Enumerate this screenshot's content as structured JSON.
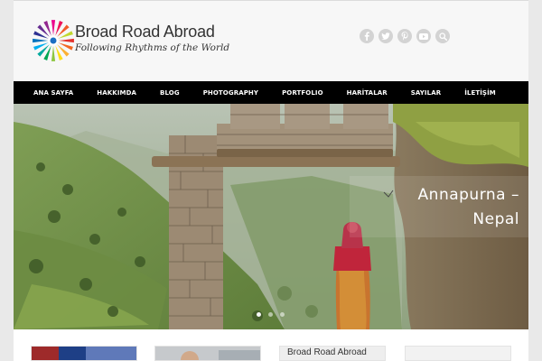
{
  "header": {
    "brand_title": "Broad Road Abroad",
    "brand_tagline": "Following Rhythms of the World",
    "social_icons": [
      "facebook-icon",
      "twitter-icon",
      "pinterest-icon",
      "youtube-icon",
      "search-icon"
    ],
    "social_color": "#d3d3d3"
  },
  "nav": {
    "items": [
      {
        "label": "ANA SAYFA"
      },
      {
        "label": "HAKKIMDA"
      },
      {
        "label": "BLOG"
      },
      {
        "label": "PHOTOGRAPHY"
      },
      {
        "label": "PORTFOLIO"
      },
      {
        "label": "HARİTALAR"
      },
      {
        "label": "SAYILAR"
      },
      {
        "label": "İLETİŞİM"
      }
    ],
    "background": "#000000"
  },
  "slider": {
    "caption_line1": "Annapurna –",
    "caption_line2": "Nepal",
    "slide_count": 3,
    "active_slide": 1
  },
  "thumbnails": {
    "items": [
      {
        "label": ""
      },
      {
        "label": ""
      },
      {
        "label": "Broad Road Abroad"
      },
      {
        "label": ""
      }
    ]
  }
}
